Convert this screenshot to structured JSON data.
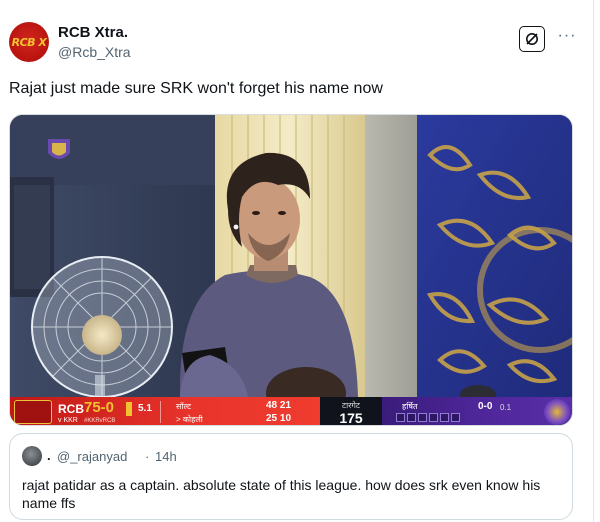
{
  "author": {
    "display_name": "RCB Xtra.",
    "handle": "@Rcb_Xtra",
    "avatar_text": "RCB X"
  },
  "actions": {
    "grok_icon": "grok-icon",
    "more_icon": "more-options-icon",
    "more_label": "···"
  },
  "tweet": {
    "text": "Rajat just made sure SRK won't forget his name now"
  },
  "media": {
    "description_icon": "photo",
    "scoreboard": {
      "team": "RCB",
      "score": "75-0",
      "overs": "5.1",
      "vs": "v KKR",
      "tag": "#KKRvRCB",
      "player1": "सॉल्ट",
      "player2": "> कोहली",
      "p1_runs": "48 21",
      "p2_runs": "25 10",
      "target_label": "टारगेट",
      "target": "175",
      "bowler": "हर्षित",
      "bowler_figures": "0-0",
      "bowler_overs": "0.1"
    }
  },
  "quote": {
    "dot": ".",
    "handle": "@_rajanyad",
    "separator": "·",
    "time": "14h",
    "text": "rajat patidar as a captain. absolute state of this league. how does srk even know his name ffs"
  },
  "colors": {
    "rcb_red": "#e8342b",
    "kkr_purple": "#4e2699",
    "gold": "#f2c230",
    "text": "#0f1419",
    "muted": "#536471"
  }
}
